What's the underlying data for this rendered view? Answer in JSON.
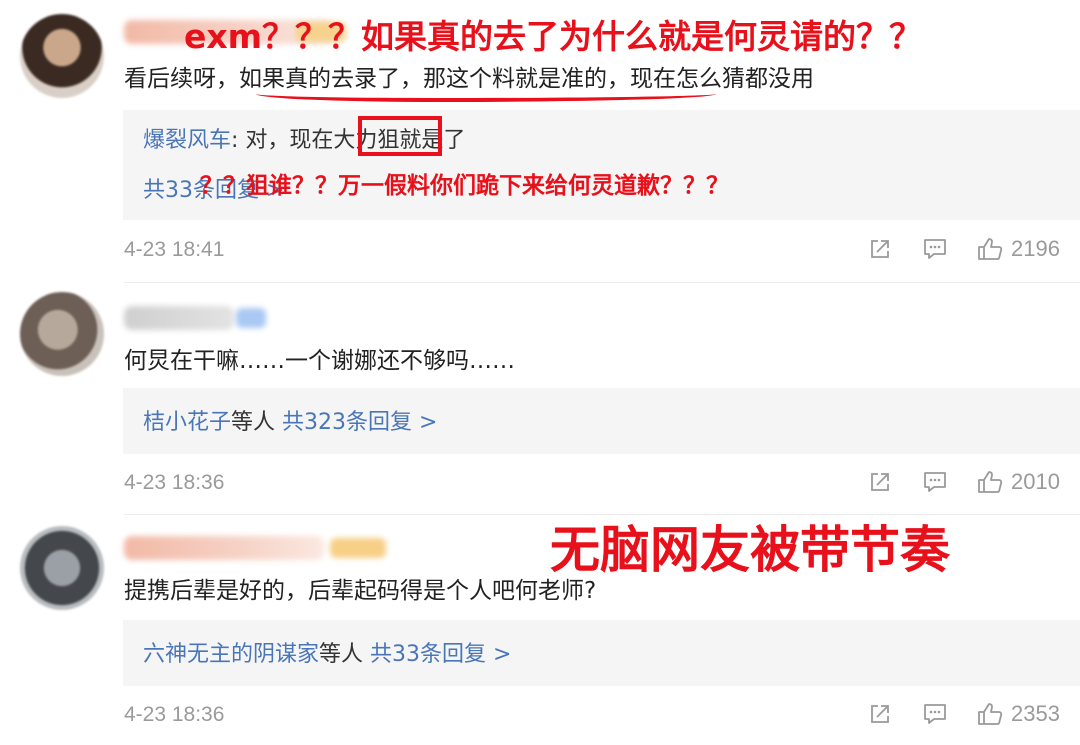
{
  "annotations": {
    "top": "exm？？？如果真的去了为什么就是何灵请的？？",
    "middle": "？？狙谁？？万一假料你们跪下来给何灵道歉？？？",
    "bottom": "无脑网友被带节奏"
  },
  "comments": [
    {
      "text": "看后续呀，如果真的去录了，那这个料就是准的，现在怎么猜都没用",
      "reply_author": "爆裂风车",
      "reply_text": ": 对，现在大力狙就是了",
      "reply_count": "共33条回复 >",
      "time": "4-23 18:41",
      "likes": "2196"
    },
    {
      "text": "何炅在干嘛……一个谢娜还不够吗……",
      "reply_author": "桔小花子",
      "reply_suffix": "等人",
      "reply_count": "共323条回复 >",
      "time": "4-23 18:36",
      "likes": "2010"
    },
    {
      "text": "提携后辈是好的，后辈起码得是个人吧何老师?",
      "reply_author": "六神无主的阴谋家",
      "reply_suffix": "等人",
      "reply_count": "共33条回复 >",
      "time": "4-23 18:36",
      "likes": "2353"
    }
  ],
  "icons": {
    "share": "share-icon",
    "comment": "comment-icon",
    "like": "thumbs-up-icon"
  },
  "colors": {
    "annotation": "#e8101a",
    "link": "#4a76b8",
    "muted": "#9a9a9a"
  }
}
